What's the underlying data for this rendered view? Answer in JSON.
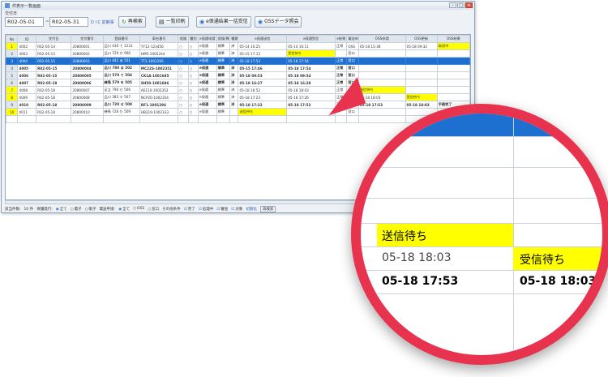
{
  "window": {
    "title": "件表示一覧画面",
    "buttons": [
      "–",
      "□",
      "✕"
    ]
  },
  "toolbar": {
    "date_label": "交付日",
    "date_from": "R02-05-01",
    "date_to": "R02-05-31",
    "tilde": "~",
    "calendar_link": "D I C 前範事",
    "buttons": [
      {
        "label": "再検索",
        "icon": "↻"
      },
      {
        "label": "一覧印刷",
        "icon": "▤"
      },
      {
        "label": "e保通結果一括受信",
        "icon": "◉"
      },
      {
        "label": "OSSデータ照会",
        "icon": "◉"
      }
    ]
  },
  "grid": {
    "headers": [
      "No",
      "ID",
      "交付日",
      "交付番号",
      "登録番号",
      "車台番号",
      "保険",
      "種別",
      "e保通申請",
      "保険/異種",
      "種類",
      "e保通送信",
      "e保通受信",
      "e結果",
      "電送申請",
      "OSS申請",
      "OSS更新",
      "OSS結果"
    ],
    "rows": [
      {
        "no": "1",
        "id": "4002",
        "date": "R02-05-14",
        "koufu": "20800001",
        "toroku": "品川 430 て 1231",
        "shadai": "YY12-123456",
        "hoken": "○",
        "shubetsu": "○",
        "esin": "e保通",
        "ishu": "標準",
        "kind": "済",
        "sousin": "05-14 10:25",
        "jusin": "05-14 16:11",
        "kekka": "正常",
        "densou": "OSS",
        "ossin": "05-18 15:38",
        "osskou": "05-18 09:32",
        "osskek": "取消中",
        "style": "yellow",
        "kek_y": true
      },
      {
        "no": "2",
        "id": "4003",
        "date": "R02-05-15",
        "koufu": "20800002",
        "toroku": "品川 729 か 900",
        "shadai": "HM5-1005244",
        "hoken": "○",
        "shubetsu": "○",
        "esin": "e保通",
        "ishu": "標準",
        "kind": "済",
        "sousin": "05-15 17:13",
        "jusin": "受信待ち",
        "kekka": "",
        "densou": "窓口",
        "ossin": "",
        "osskou": "",
        "osskek": "",
        "style": "",
        "jusin_y": true
      },
      {
        "no": "3",
        "id": "4004",
        "date": "R02-05-15",
        "koufu": "20800003",
        "toroku": "品川 442 あ 501",
        "shadai": "TT2-1001295",
        "hoken": "○",
        "shubetsu": "○",
        "esin": "e保通",
        "ishu": "標準",
        "kind": "済",
        "sousin": "05-18 17:53",
        "jusin": "05-18 17:54",
        "kekka": "正常",
        "densou": "窓口",
        "ossin": "",
        "osskou": "",
        "osskek": "",
        "style": "selected"
      },
      {
        "no": "4",
        "id": "4005",
        "date": "R02-05-15",
        "koufu": "20800004",
        "toroku": "品川 780 ま 502",
        "shadai": "MC22S-1002351",
        "hoken": "○",
        "shubetsu": "○",
        "esin": "e保通",
        "ishu": "標準",
        "kind": "済",
        "sousin": "05-15 17:46",
        "jusin": "05-18 17:54",
        "kekka": "正常",
        "densou": "窓口",
        "ossin": "",
        "osskou": "",
        "osskek": "",
        "style": "bold"
      },
      {
        "no": "5",
        "id": "4006",
        "date": "R02-05-15",
        "koufu": "20800005",
        "toroku": "品川 570 て 504",
        "shadai": "CK1A-1001685",
        "hoken": "○",
        "shubetsu": "○",
        "esin": "e保通",
        "ishu": "標準",
        "kind": "済",
        "sousin": "05-18 09:53",
        "jusin": "05-18 09:54",
        "kekka": "正常",
        "densou": "窓口",
        "ossin": "",
        "osskou": "",
        "osskek": "",
        "style": "bold"
      },
      {
        "no": "6",
        "id": "4007",
        "date": "R02-05-18",
        "koufu": "20800006",
        "toroku": "練馬 579 を 505",
        "shadai": "SH50-1001686",
        "hoken": "○",
        "shubetsu": "○",
        "esin": "e保通",
        "ishu": "標準",
        "kind": "済",
        "sousin": "05-18 16:27",
        "jusin": "05-18 16:28",
        "kekka": "正常",
        "densou": "窓口",
        "ossin": "",
        "osskou": "",
        "osskek": "",
        "style": "bold"
      },
      {
        "no": "7",
        "id": "4008",
        "date": "R02-05-18",
        "koufu": "20800007",
        "toroku": "足立 790 せ 506",
        "shadai": "AE110-1002352",
        "hoken": "○",
        "shubetsu": "○",
        "esin": "e保通",
        "ishu": "標準",
        "kind": "済",
        "sousin": "05-18 16:52",
        "jusin": "05-18 18:03",
        "kekka": "正常",
        "densou": "OSS",
        "ossin": "送信待ち",
        "osskou": "",
        "osskek": "",
        "style": "yellow",
        "ossin_y": true
      },
      {
        "no": "8",
        "id": "4009",
        "date": "R02-05-18",
        "koufu": "20800008",
        "toroku": "品川 383 す 507",
        "shadai": "NCP20-1002354",
        "hoken": "○",
        "shubetsu": "○",
        "esin": "e保通",
        "ishu": "標準",
        "kind": "済",
        "sousin": "05-18 17:23",
        "jusin": "05-18 17:26",
        "kekka": "正常",
        "densou": "OSS",
        "ossin": "05-18 18:03",
        "osskou": "受信待ち",
        "osskek": "",
        "style": "yellow",
        "osskou_y": true
      },
      {
        "no": "9",
        "id": "4010",
        "date": "R02-05-18",
        "koufu": "20800009",
        "toroku": "品川 720 せ 508",
        "shadai": "RF1-1001296",
        "hoken": "○",
        "shubetsu": "○",
        "esin": "e保通",
        "ishu": "標準",
        "kind": "済",
        "sousin": "05-18 17:32",
        "jusin": "05-18 17:53",
        "kekka": "正常",
        "densou": "OSS",
        "ossin": "05-18 17:53",
        "osskou": "05-18 18:03",
        "osskek": "手続完了",
        "style": "bold"
      },
      {
        "no": "10",
        "id": "4011",
        "date": "R02-05-18",
        "koufu": "20800010",
        "toroku": "練馬 726 た 509",
        "shadai": "HB219-1002333",
        "hoken": "○",
        "shubetsu": "○",
        "esin": "e保通",
        "ishu": "標準",
        "kind": "",
        "sousin": "送信待ち",
        "jusin": "",
        "kekka": "",
        "densou": "窓口",
        "ossin": "",
        "osskou": "",
        "osskek": "",
        "style": "yellow",
        "sousin_y": true
      }
    ]
  },
  "statusbar": {
    "count_label": "該当件数:",
    "count": "10 件",
    "hoken_label": "保護発行:",
    "hoken_opts": [
      "全て",
      "電子",
      "帳子"
    ],
    "densou_label": "電送申請:",
    "densou_opts": [
      "全て",
      "OSS",
      "窓口"
    ],
    "other_label": "その他条件",
    "checks": [
      "完了",
      "処理中",
      "審査",
      "対象"
    ],
    "reset": "初期化",
    "print": "再検索"
  },
  "magnifier": {
    "row1_left": "送信待ち",
    "row2_left": "05-18 18:03",
    "row2_right": "受信待ち",
    "row3_left": "05-18 17:53",
    "row3_right": "05-18 18:03"
  },
  "colors": {
    "accent": "#1d6fd0",
    "highlight": "#ffff00",
    "ring": "#e8334e"
  }
}
